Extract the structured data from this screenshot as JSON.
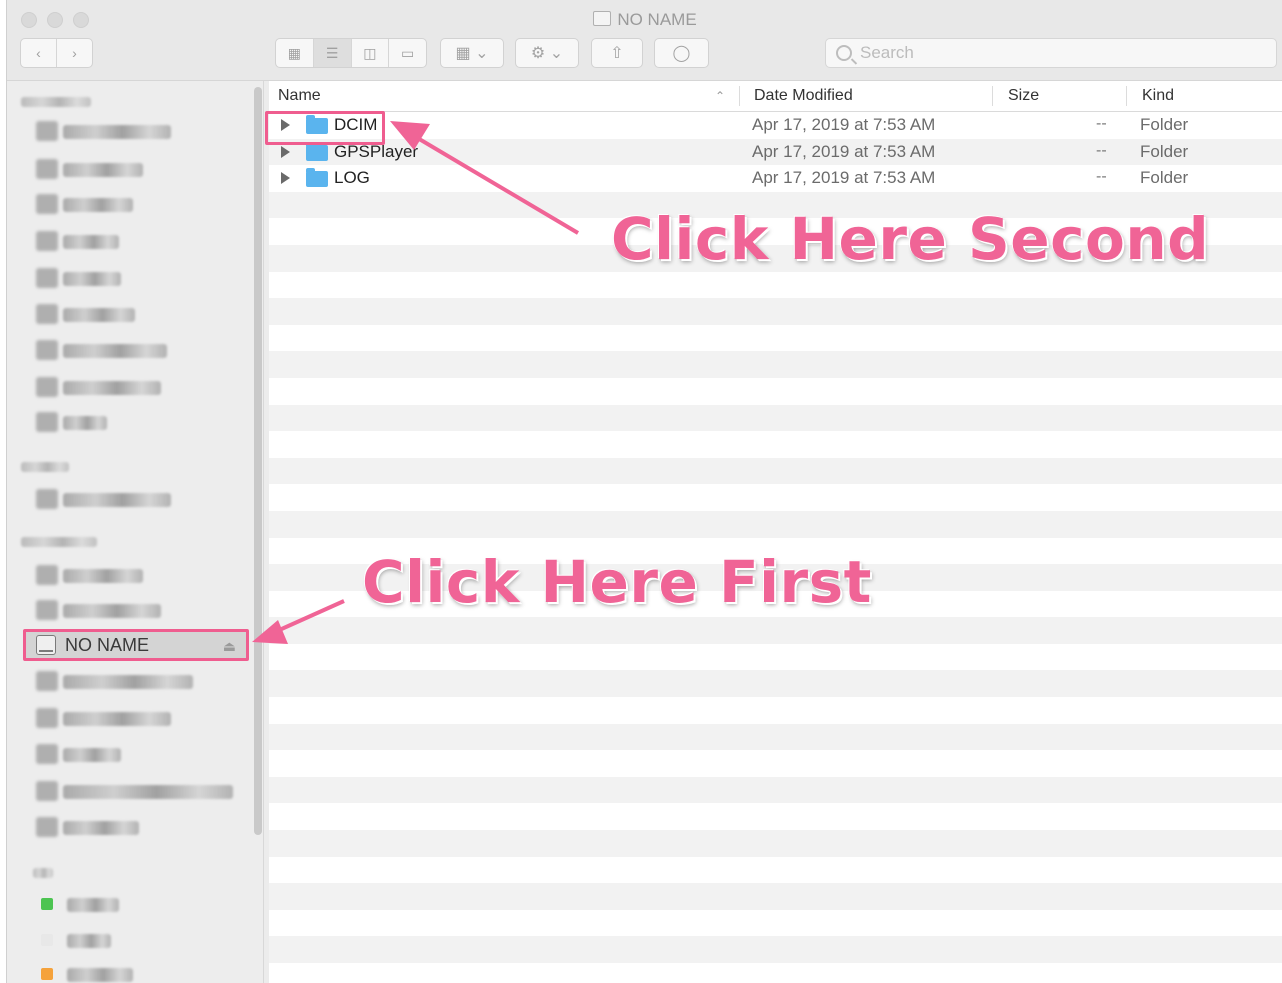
{
  "window": {
    "title": "NO NAME",
    "toolbar": {
      "back_icon": "chevron-left-icon",
      "forward_icon": "chevron-right-icon",
      "view_modes": [
        "icon-view-icon",
        "list-view-icon",
        "column-view-icon",
        "gallery-view-icon"
      ],
      "active_view": "list-view-icon",
      "group_icon": "grid-icon",
      "action_icon": "gear-icon",
      "share_icon": "share-icon",
      "tag_icon": "tag-icon",
      "search_placeholder": "Search"
    }
  },
  "sidebar": {
    "selected_item": {
      "label": "NO NAME",
      "icon": "drive-icon",
      "eject_icon": "eject-icon"
    },
    "tag_colors": [
      "#4cc451",
      "#e8e8e8",
      "#f5a23b"
    ]
  },
  "file_list": {
    "columns": {
      "name": "Name",
      "date_modified": "Date Modified",
      "size": "Size",
      "kind": "Kind"
    },
    "rows": [
      {
        "name": "DCIM",
        "date_modified": "Apr 17, 2019 at 7:53 AM",
        "size": "--",
        "kind": "Folder"
      },
      {
        "name": "GPSPlayer",
        "date_modified": "Apr 17, 2019 at 7:53 AM",
        "size": "--",
        "kind": "Folder"
      },
      {
        "name": "LOG",
        "date_modified": "Apr 17, 2019 at 7:53 AM",
        "size": "--",
        "kind": "Folder"
      }
    ]
  },
  "annotations": {
    "second": "Click Here Second",
    "first": "Click Here First",
    "color": "#f06496"
  }
}
